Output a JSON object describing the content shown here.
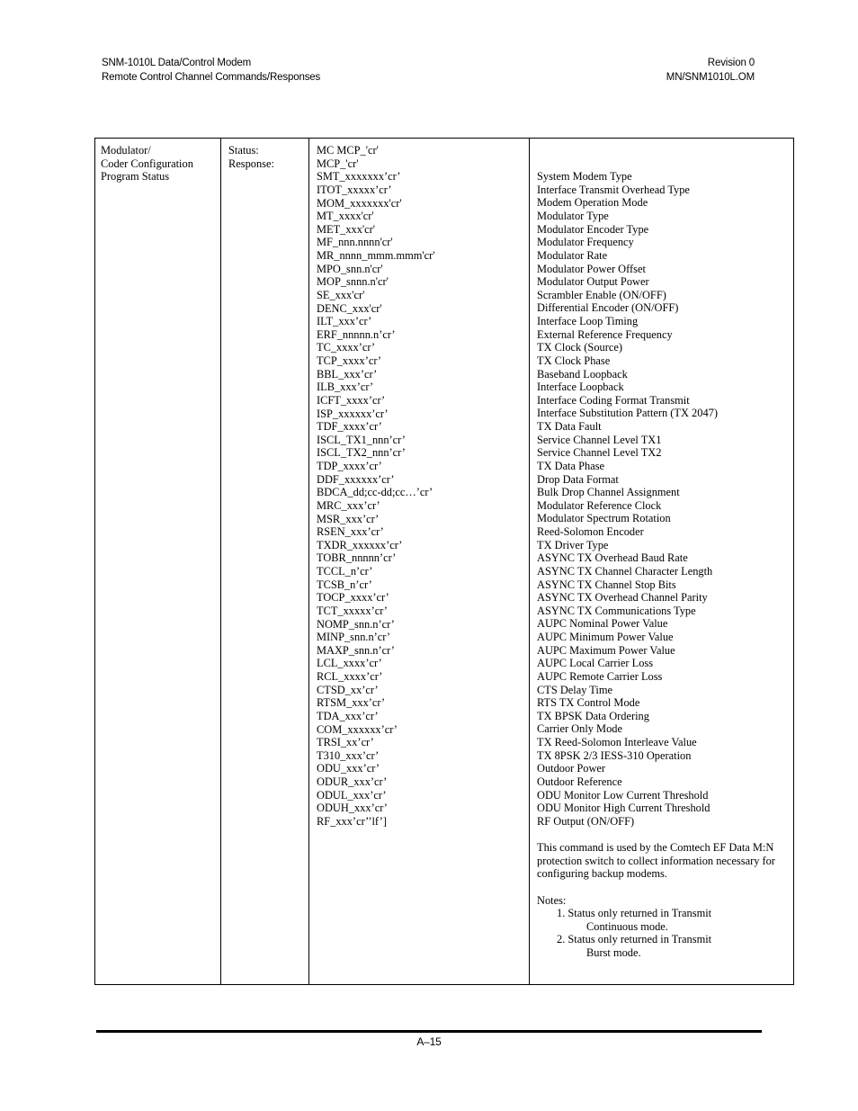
{
  "header": {
    "left_line1": "SNM-1010L Data/Control Modem",
    "left_line2": "Remote Control Channel Commands/Responses",
    "right_line1": "Revision 0",
    "right_line2": "MN/SNM1010L.OM"
  },
  "footer": {
    "page_number": "A–15"
  },
  "table": {
    "name_cell": {
      "line1": "Modulator/",
      "line2": "Coder Configuration",
      "line3": "Program Status"
    },
    "type_cell": {
      "line1": "Status:",
      "line2": "Response:"
    },
    "commands": [
      "MC MCP_'cr'",
      "MCP_'cr'",
      "SMT_xxxxxxx’cr’",
      "ITOT_xxxxx’cr’",
      "MOM_xxxxxxx'cr'",
      "MT_xxxx'cr'",
      "MET_xxx'cr'",
      "MF_nnn.nnnn'cr'",
      "MR_nnnn_mmm.mmm'cr'",
      "MPO_snn.n'cr'",
      "MOP_snnn.n'cr'",
      "SE_xxx'cr'",
      "DENC_xxx'cr'",
      "ILT_xxx’cr’",
      "ERF_nnnnn.n’cr’",
      "TC_xxxx’cr’",
      "TCP_xxxx’cr’",
      "BBL_xxx’cr’",
      "ILB_xxx’cr’",
      "ICFT_xxxx’cr’",
      "ISP_xxxxxx’cr’",
      "TDF_xxxx’cr’",
      "ISCL_TX1_nnn’cr’",
      "ISCL_TX2_nnn’cr’",
      "TDP_xxxx’cr’",
      "DDF_xxxxxx’cr’",
      "BDCA_dd;cc-dd;cc…’cr’",
      "MRC_xxx’cr’",
      "MSR_xxx’cr’",
      "RSEN_xxx’cr’",
      "TXDR_xxxxxx’cr’",
      "TOBR_nnnnn’cr’",
      "TCCL_n’cr’",
      "TCSB_n’cr’",
      "TOCP_xxxx’cr’",
      "TCT_xxxxx’cr’",
      "NOMP_snn.n’cr’",
      "MINP_snn.n’cr’",
      "MAXP_snn.n’cr’",
      "LCL_xxxx’cr’",
      "RCL_xxxx’cr’",
      "CTSD_xx’cr’",
      "RTSM_xxx’cr’",
      "TDA_xxx’cr’",
      "COM_xxxxxx’cr’",
      "TRSI_xx’cr’",
      "T310_xxx’cr’",
      "ODU_xxx’cr’",
      "ODUR_xxx’cr’",
      "ODUL_xxx’cr’",
      "ODUH_xxx’cr’",
      "RF_xxx’cr’’lf’]"
    ],
    "descriptions": [
      "System Modem Type",
      "Interface Transmit Overhead Type",
      "Modem Operation Mode",
      "Modulator Type",
      "Modulator Encoder Type",
      "Modulator Frequency",
      "Modulator Rate",
      "Modulator Power Offset",
      "Modulator Output Power",
      "Scrambler Enable (ON/OFF)",
      "Differential Encoder (ON/OFF)",
      "Interface Loop Timing",
      "External Reference Frequency",
      "TX Clock (Source)",
      "TX Clock Phase",
      "Baseband Loopback",
      "Interface Loopback",
      "Interface Coding Format Transmit",
      "Interface Substitution Pattern (TX 2047)",
      "TX Data Fault",
      "Service Channel Level TX1",
      "Service Channel Level TX2",
      "TX Data Phase",
      "Drop Data Format",
      "Bulk Drop Channel Assignment",
      "Modulator Reference Clock",
      "Modulator Spectrum Rotation",
      "Reed-Solomon Encoder",
      "TX Driver Type",
      "ASYNC TX Overhead Baud Rate",
      "ASYNC TX Channel Character Length",
      "ASYNC TX Channel Stop Bits",
      "ASYNC TX Overhead Channel Parity",
      "ASYNC TX Communications Type",
      "AUPC Nominal Power Value",
      "AUPC Minimum Power Value",
      "AUPC Maximum Power Value",
      "AUPC Local Carrier Loss",
      "AUPC Remote Carrier Loss",
      "CTS Delay Time",
      "RTS TX Control Mode",
      "TX BPSK Data Ordering",
      "Carrier Only Mode",
      "TX Reed-Solomon Interleave Value",
      "TX 8PSK 2/3 IESS-310 Operation",
      "Outdoor Power",
      "Outdoor Reference",
      "ODU Monitor Low Current Threshold",
      "ODU Monitor High Current Threshold",
      "RF Output (ON/OFF)"
    ],
    "notes": {
      "paragraph": "This command is used by the Comtech EF Data M:N protection switch to collect information necessary for configuring backup modems.",
      "heading": "Notes:",
      "items": [
        {
          "main": "1. Status only returned in Transmit",
          "sub": "Continuous mode."
        },
        {
          "main": "2. Status only returned in Transmit",
          "sub": "Burst mode."
        }
      ]
    }
  }
}
